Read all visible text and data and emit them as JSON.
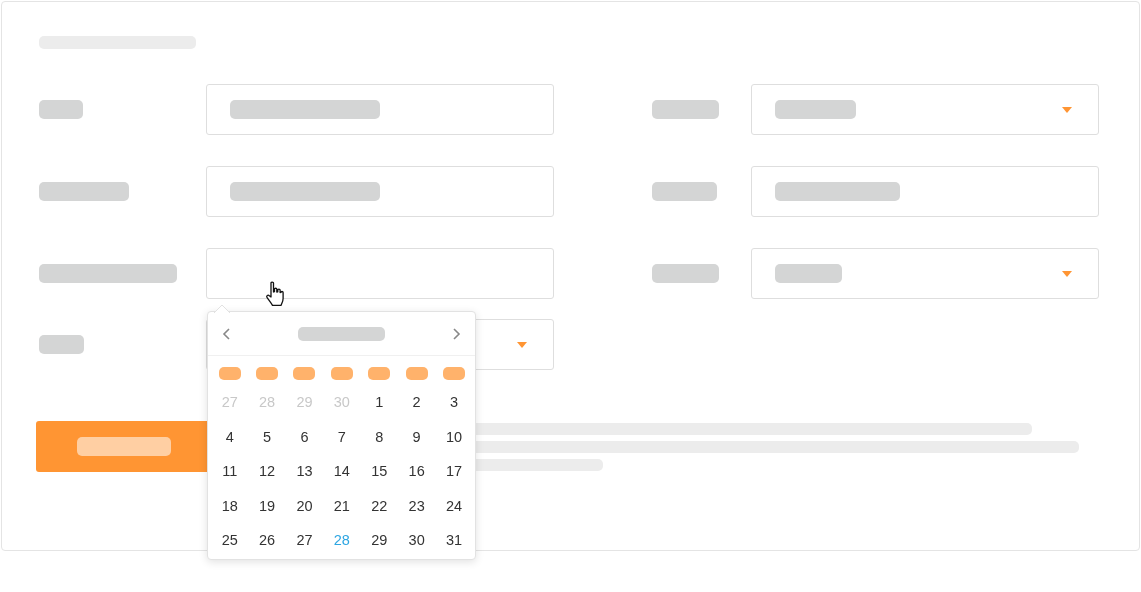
{
  "form": {
    "left_fields": [
      {
        "kind": "text"
      },
      {
        "kind": "text"
      },
      {
        "kind": "date",
        "open": true
      },
      {
        "kind": "select"
      }
    ],
    "right_fields": [
      {
        "kind": "select"
      },
      {
        "kind": "text"
      },
      {
        "kind": "select"
      }
    ]
  },
  "calendar": {
    "days": [
      {
        "label": "27",
        "outside": true,
        "today": false
      },
      {
        "label": "28",
        "outside": true,
        "today": false
      },
      {
        "label": "29",
        "outside": true,
        "today": false
      },
      {
        "label": "30",
        "outside": true,
        "today": false
      },
      {
        "label": "1",
        "outside": false,
        "today": false
      },
      {
        "label": "2",
        "outside": false,
        "today": false
      },
      {
        "label": "3",
        "outside": false,
        "today": false
      },
      {
        "label": "4",
        "outside": false,
        "today": false
      },
      {
        "label": "5",
        "outside": false,
        "today": false
      },
      {
        "label": "6",
        "outside": false,
        "today": false
      },
      {
        "label": "7",
        "outside": false,
        "today": false
      },
      {
        "label": "8",
        "outside": false,
        "today": false
      },
      {
        "label": "9",
        "outside": false,
        "today": false
      },
      {
        "label": "10",
        "outside": false,
        "today": false
      },
      {
        "label": "11",
        "outside": false,
        "today": false
      },
      {
        "label": "12",
        "outside": false,
        "today": false
      },
      {
        "label": "13",
        "outside": false,
        "today": false
      },
      {
        "label": "14",
        "outside": false,
        "today": false
      },
      {
        "label": "15",
        "outside": false,
        "today": false
      },
      {
        "label": "16",
        "outside": false,
        "today": false
      },
      {
        "label": "17",
        "outside": false,
        "today": false
      },
      {
        "label": "18",
        "outside": false,
        "today": false
      },
      {
        "label": "19",
        "outside": false,
        "today": false
      },
      {
        "label": "20",
        "outside": false,
        "today": false
      },
      {
        "label": "21",
        "outside": false,
        "today": false
      },
      {
        "label": "22",
        "outside": false,
        "today": false
      },
      {
        "label": "23",
        "outside": false,
        "today": false
      },
      {
        "label": "24",
        "outside": false,
        "today": false
      },
      {
        "label": "25",
        "outside": false,
        "today": false
      },
      {
        "label": "26",
        "outside": false,
        "today": false
      },
      {
        "label": "27",
        "outside": false,
        "today": false
      },
      {
        "label": "28",
        "outside": false,
        "today": true
      },
      {
        "label": "29",
        "outside": false,
        "today": false
      },
      {
        "label": "30",
        "outside": false,
        "today": false
      },
      {
        "label": "31",
        "outside": false,
        "today": false
      }
    ]
  }
}
